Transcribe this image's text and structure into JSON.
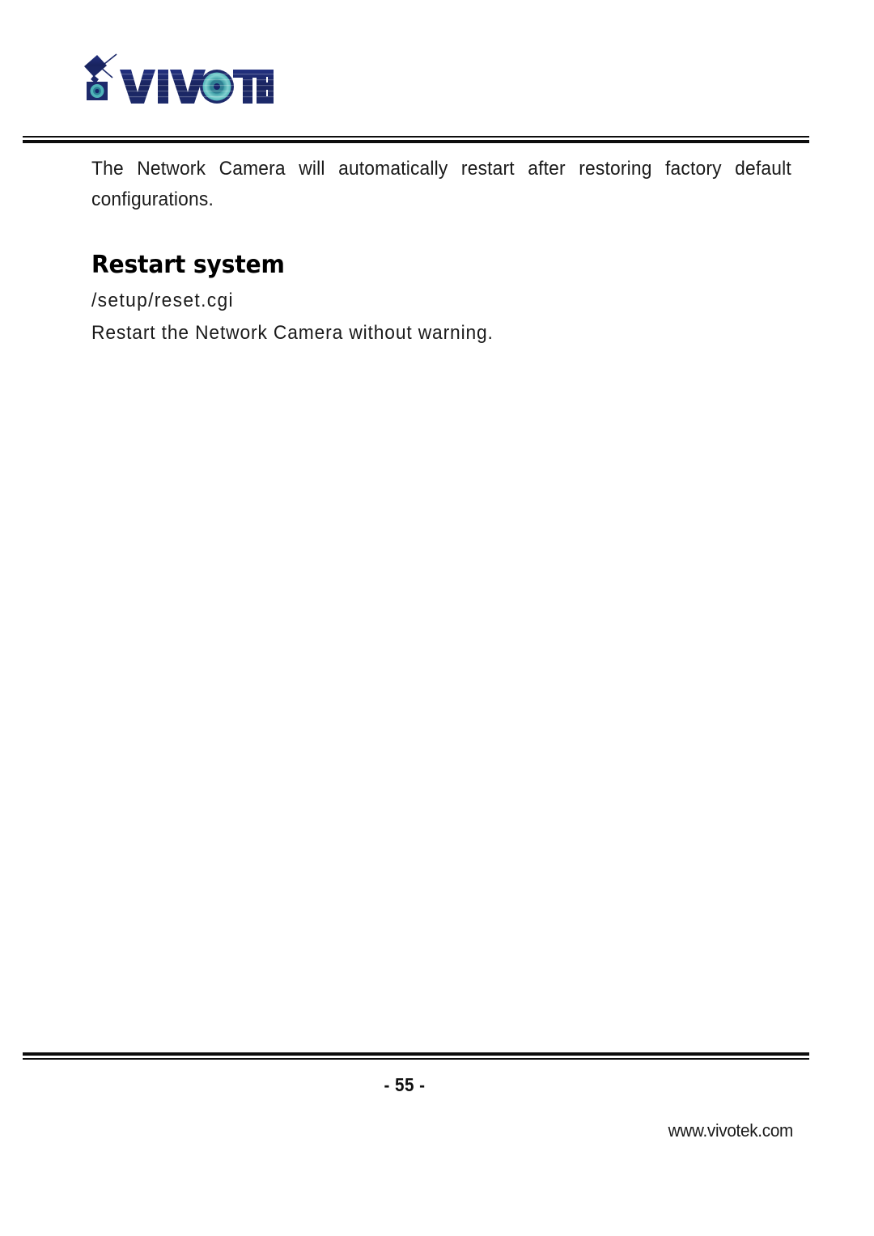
{
  "document": {
    "brand": "VIVOTEK",
    "logo_icon": "network-camera-logo-icon",
    "colors": {
      "logo_navy": "#1d2a6b",
      "logo_teal": "#4fb3b8",
      "logo_lens_inner": "#16266a",
      "rule": "#0d0d0d",
      "text": "#1a1a1a"
    }
  },
  "body": {
    "intro_paragraph": "The Network Camera will automatically restart after restoring factory default configurations.",
    "heading": "Restart system",
    "cgi_path": "/setup/reset.cgi",
    "cgi_description": "Restart the Network Camera without warning."
  },
  "footer": {
    "page_number": "- 55 -",
    "website": "www.vivotek.com"
  }
}
